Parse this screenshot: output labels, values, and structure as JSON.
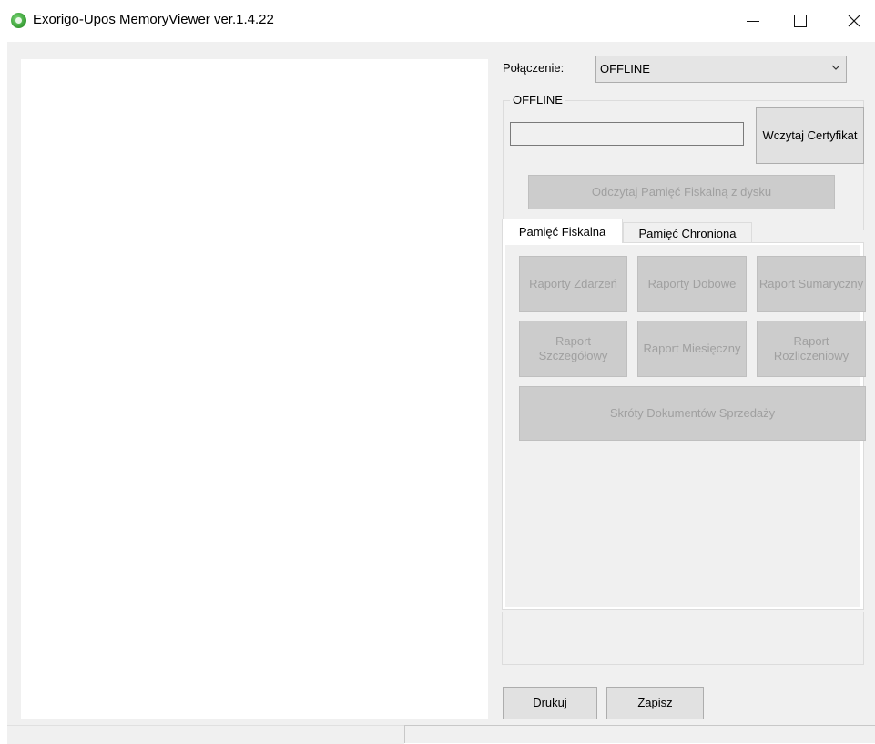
{
  "window": {
    "title": "Exorigo-Upos MemoryViewer ver.1.4.22",
    "controls": [
      "minimize",
      "maximize",
      "close"
    ]
  },
  "connection": {
    "label": "Połączenie:",
    "selected": "OFFLINE"
  },
  "offline_group": {
    "title": "OFFLINE",
    "certificate_path": "",
    "load_certificate_label": "Wczytaj Certyfikat",
    "read_from_disk_label": "Odczytaj Pamięć Fiskalną z dysku"
  },
  "tabs": [
    {
      "label": "Pamięć Fiskalna",
      "active": true
    },
    {
      "label": "Pamięć Chroniona",
      "active": false
    }
  ],
  "report_buttons": {
    "row1": [
      "Raporty Zdarzeń",
      "Raporty Dobowe",
      "Raport Sumaryczny"
    ],
    "row2": [
      "Raport Szczegółowy",
      "Raport Miesięczny",
      "Raport Rozliczeniowy"
    ],
    "wide": "Skróty Dokumentów Sprzedaży"
  },
  "footer": {
    "print_label": "Drukuj",
    "save_label": "Zapisz"
  },
  "colors": {
    "window_bg": "#f0f0f0",
    "disabled_button_bg": "#cccccc",
    "disabled_text": "#a0a0a0",
    "app_icon": "#3da33a"
  }
}
